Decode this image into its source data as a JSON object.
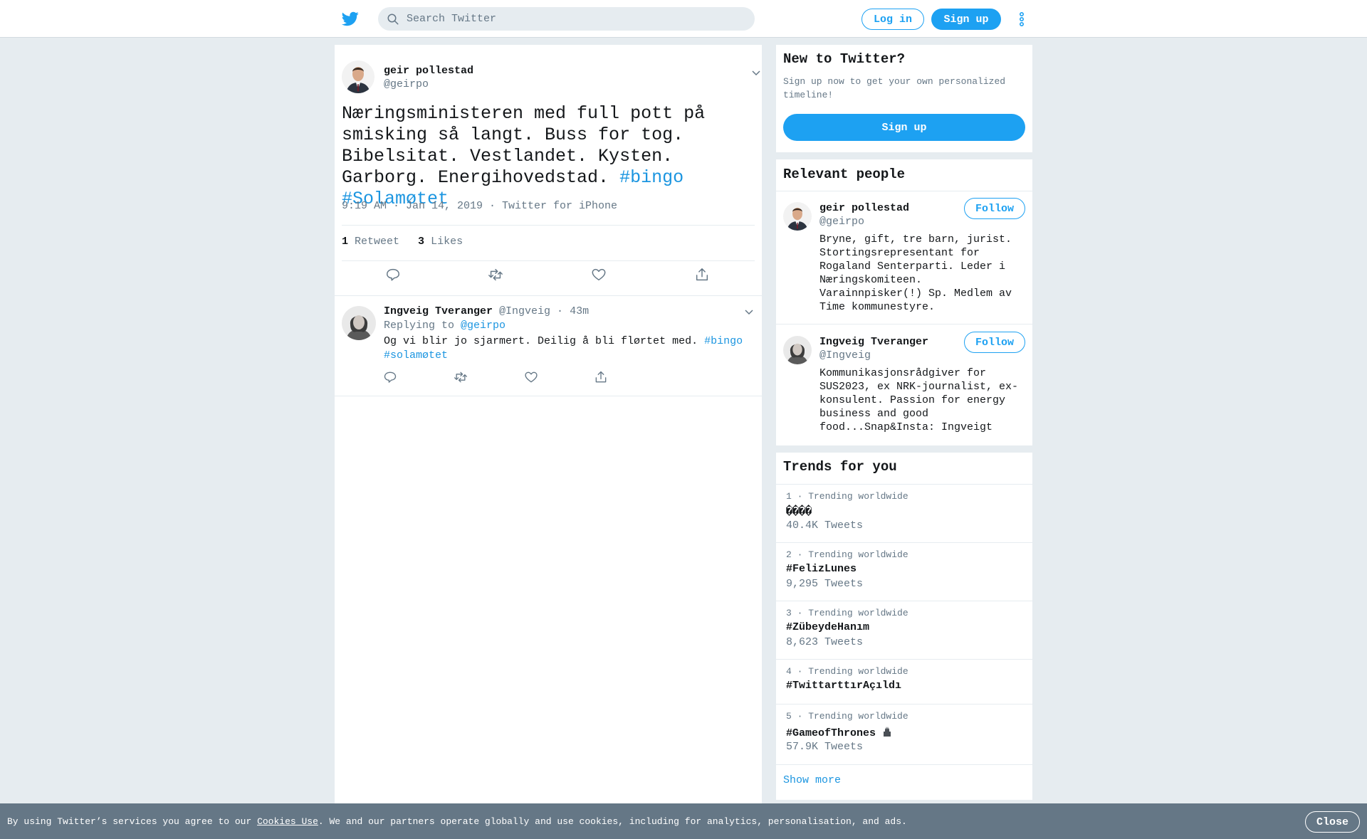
{
  "header": {
    "search_placeholder": "Search Twitter",
    "login_label": "Log in",
    "signup_label": "Sign up"
  },
  "tweet": {
    "author_name": "geir pollestad",
    "author_handle": "@geirpo",
    "text": "Næringsministeren med full pott på smisking så langt. Buss for tog. Bibelsitat. Vestlandet. Kysten. Garborg. Energihovedstad.",
    "hashtag_1": "#bingo",
    "hashtag_2": "#Solamøtet",
    "meta": "9:19 AM · Jan 14, 2019 · Twitter for iPhone",
    "retweet_count": "1",
    "retweet_label": "Retweet",
    "likes_count": "3",
    "likes_label": "Likes"
  },
  "reply": {
    "name": "Ingveig Tveranger",
    "handle_time": "@Ingveig · 43m",
    "replying_to_label": "Replying to",
    "replying_to_handle": "@geirpo",
    "text": "Og vi blir jo sjarmert. Deilig å bli flørtet med.",
    "hashtag_1": "#bingo",
    "hashtag_2": "#solamøtet"
  },
  "new_to_twitter": {
    "title": "New to Twitter?",
    "subtitle": "Sign up now to get your own personalized timeline!",
    "button": "Sign up"
  },
  "relevant_people": {
    "title": "Relevant people",
    "follow_label": "Follow",
    "people": [
      {
        "name": "geir pollestad",
        "handle": "@geirpo",
        "bio": "Bryne, gift, tre barn, jurist. Stortingsrepresentant for Rogaland Senterparti. Leder i Næringskomiteen. Varainnpisker(!) Sp. Medlem av Time kommunestyre."
      },
      {
        "name": "Ingveig Tveranger",
        "handle": "@Ingveig",
        "bio": "Kommunikasjonsrådgiver for SUS2023, ex NRK-journalist, ex-konsulent. Passion for energy business and good food...Snap&Insta: Ingveigt"
      }
    ]
  },
  "trends": {
    "title": "Trends for you",
    "show_more": "Show more",
    "items": [
      {
        "meta": "1 · Trending worldwide",
        "name": "����",
        "count": "40.4K Tweets"
      },
      {
        "meta": "2 · Trending worldwide",
        "name": "#FelizLunes",
        "count": "9,295 Tweets"
      },
      {
        "meta": "3 · Trending worldwide",
        "name": "#ZübeydeHanım",
        "count": "8,623 Tweets"
      },
      {
        "meta": "4 · Trending worldwide",
        "name": "#TwittarttırAçıldı",
        "count": ""
      },
      {
        "meta": "5 · Trending worldwide",
        "name": "#GameofThrones",
        "count": "57.9K Tweets"
      }
    ]
  },
  "cookie_bar": {
    "text_before": "By using Twitter’s services you agree to our ",
    "link": "Cookies Use",
    "text_after": ". We and our partners operate globally and use cookies, including for analytics, personalisation, and ads.",
    "close_label": "Close"
  },
  "colors": {
    "brand_blue": "#1da1f2",
    "link_blue": "#1b95e0",
    "page_bg": "#e6ecf0",
    "muted_text": "#657786",
    "cookie_bg": "#657786"
  }
}
